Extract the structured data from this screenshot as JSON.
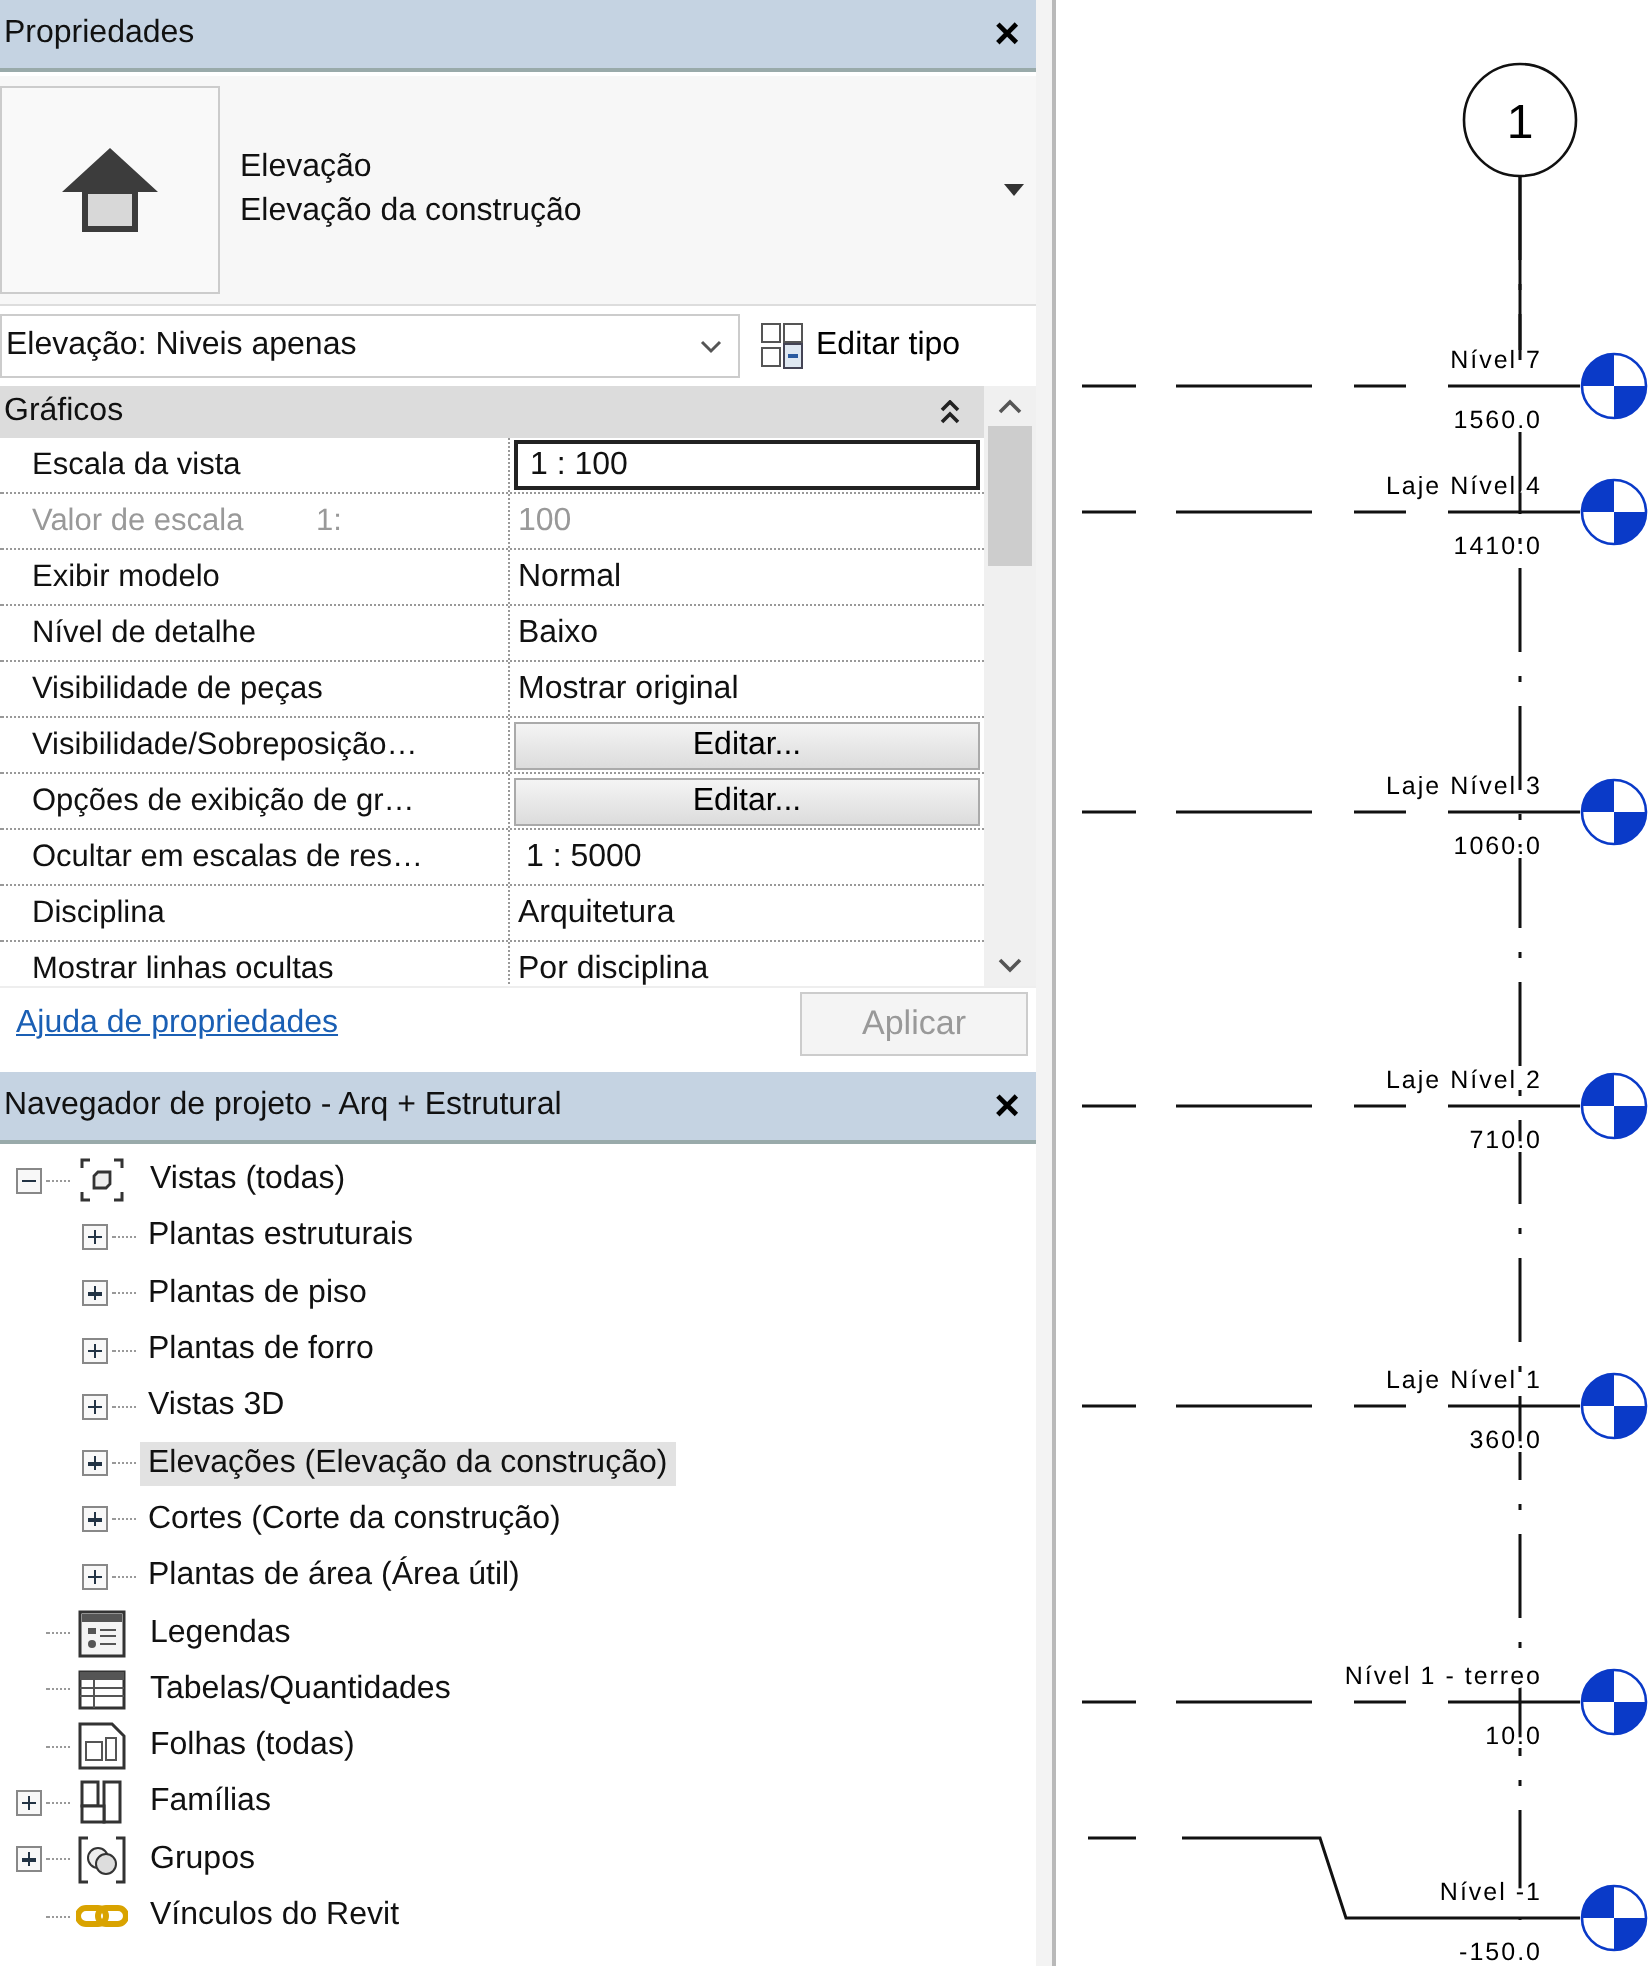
{
  "properties_panel": {
    "title": "Propriedades",
    "close": "×",
    "type_selector": {
      "family": "Elevação",
      "type": "Elevação da construção"
    },
    "instance_filter": "Elevação: Niveis apenas",
    "edit_type_button": "Editar tipo",
    "group": {
      "title": "Gráficos",
      "expanded": true
    },
    "rows": [
      {
        "label": "Escala da vista",
        "value": "1 : 100",
        "kind": "input",
        "disabled": false
      },
      {
        "label": "Valor de escala",
        "unit": "1:",
        "value": "100",
        "kind": "text",
        "disabled": true
      },
      {
        "label": "Exibir modelo",
        "value": "Normal",
        "kind": "text",
        "disabled": false
      },
      {
        "label": "Nível de detalhe",
        "value": "Baixo",
        "kind": "text",
        "disabled": false
      },
      {
        "label": "Visibilidade de peças",
        "value": "Mostrar original",
        "kind": "text",
        "disabled": false
      },
      {
        "label": "Visibilidade/Sobreposição…",
        "value": "Editar...",
        "kind": "button",
        "disabled": false
      },
      {
        "label": "Opções de exibição de gr…",
        "value": "Editar...",
        "kind": "button",
        "disabled": false
      },
      {
        "label": "Ocultar em escalas de res…",
        "value": "1 : 5000",
        "kind": "input-plain",
        "disabled": false
      },
      {
        "label": "Disciplina",
        "value": "Arquitetura",
        "kind": "text",
        "disabled": false
      },
      {
        "label": "Mostrar linhas ocultas",
        "value": "Por disciplina",
        "kind": "text",
        "disabled": false
      }
    ],
    "help_link": "Ajuda de propriedades",
    "apply_button": {
      "label": "Aplicar",
      "disabled": true
    }
  },
  "project_browser": {
    "title": "Navegador de projeto - Arq + Estrutural",
    "close": "×",
    "tree": [
      {
        "label": "Vistas (todas)",
        "kind": "views",
        "expanded": true,
        "selected": false,
        "children": [
          {
            "label": "Plantas estruturais",
            "expanded": false,
            "selected": false
          },
          {
            "label": "Plantas de piso",
            "expanded": false,
            "selected": false
          },
          {
            "label": "Plantas de forro",
            "expanded": false,
            "selected": false
          },
          {
            "label": "Vistas 3D",
            "expanded": false,
            "selected": false
          },
          {
            "label": "Elevações (Elevação da construção)",
            "expanded": false,
            "selected": true
          },
          {
            "label": "Cortes (Corte da construção)",
            "expanded": false,
            "selected": false
          },
          {
            "label": "Plantas de área (Área útil)",
            "expanded": false,
            "selected": false
          }
        ]
      },
      {
        "label": "Legendas",
        "kind": "legends",
        "selected": false
      },
      {
        "label": "Tabelas/Quantidades",
        "kind": "schedules",
        "selected": false
      },
      {
        "label": "Folhas (todas)",
        "kind": "sheets",
        "selected": false
      },
      {
        "label": "Famílias",
        "kind": "families",
        "expanded": false,
        "selected": false
      },
      {
        "label": "Grupos",
        "kind": "groups",
        "expanded": false,
        "selected": false
      },
      {
        "label": "Vínculos do Revit",
        "kind": "links",
        "selected": false
      }
    ]
  },
  "canvas": {
    "grid": {
      "label": "1"
    },
    "levels": [
      {
        "name": "Nível 7",
        "elevation": "1560.0",
        "kind": "straight"
      },
      {
        "name": "Laje Nível 4",
        "elevation": "1410.0",
        "kind": "straight"
      },
      {
        "name": "Laje Nível 3",
        "elevation": "1060.0",
        "kind": "straight"
      },
      {
        "name": "Laje Nível 2",
        "elevation": "710.0",
        "kind": "straight"
      },
      {
        "name": "Laje Nível 1",
        "elevation": "360.0",
        "kind": "straight"
      },
      {
        "name": "Nível 1 - terreo",
        "elevation": "10.0",
        "kind": "straight"
      },
      {
        "name": "Nível -1",
        "elevation": "-150.0",
        "kind": "elbow"
      }
    ]
  }
}
